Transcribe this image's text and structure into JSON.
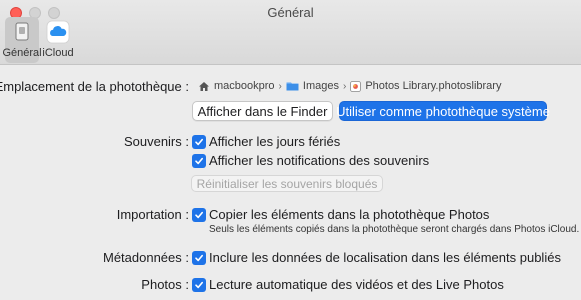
{
  "window": {
    "title": "Général"
  },
  "toolbar": {
    "items": [
      {
        "label": "Général",
        "icon": "general-icon",
        "selected": true
      },
      {
        "label": "iCloud",
        "icon": "icloud-icon",
        "selected": false
      }
    ]
  },
  "library": {
    "label": "Emplacement de la photothèque :",
    "path": [
      {
        "icon": "home-icon",
        "text": "macbookpro"
      },
      {
        "icon": "folder-icon",
        "text": "Images"
      },
      {
        "icon": "photos-library-icon",
        "text": "Photos Library.photoslibrary"
      }
    ],
    "show_in_finder": "Afficher dans le Finder",
    "use_as_system": "Utiliser comme photothèque système"
  },
  "memories": {
    "label": "Souvenirs :",
    "holidays": {
      "text": "Afficher les jours fériés",
      "checked": true
    },
    "notifications": {
      "text": "Afficher les notifications des souvenirs",
      "checked": true
    },
    "reset_button": "Réinitialiser les souvenirs bloqués"
  },
  "importing": {
    "label": "Importation :",
    "copy": {
      "text": "Copier les éléments dans la photothèque Photos",
      "checked": true
    },
    "note": "Seuls les éléments copiés dans la photothèque seront chargés dans Photos iCloud."
  },
  "metadata": {
    "label": "Métadonnées :",
    "location": {
      "text": "Inclure les données de localisation dans les éléments publiés",
      "checked": true
    }
  },
  "photos": {
    "label": "Photos :",
    "autoplay": {
      "text": "Lecture automatique des vidéos et des Live Photos",
      "checked": true
    }
  },
  "colors": {
    "accent": "#1e73e8",
    "close": "#ff5f57"
  }
}
